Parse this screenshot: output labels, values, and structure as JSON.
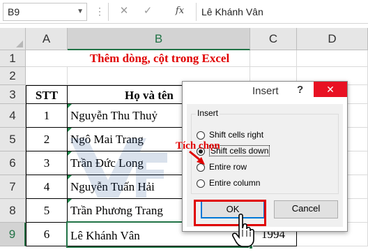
{
  "formula_bar": {
    "name_box": "B9",
    "cancel_icon": "✕",
    "enter_icon": "✓",
    "fx_label": "fx",
    "value": "Lê Khánh Vân"
  },
  "columns": [
    "A",
    "B",
    "C",
    "D"
  ],
  "rows": [
    "1",
    "2",
    "3",
    "4",
    "5",
    "6",
    "7",
    "8",
    "9"
  ],
  "sheet": {
    "title": "Thêm dòng, cột trong Excel",
    "header_stt": "STT",
    "header_name": "Họ và tên",
    "records": [
      {
        "stt": "1",
        "name": "Nguyễn Thu Thuỷ"
      },
      {
        "stt": "2",
        "name": "Ngô Mai Trang"
      },
      {
        "stt": "3",
        "name": "Trần Đức Long"
      },
      {
        "stt": "4",
        "name": "Nguyễn Tuấn Hải"
      },
      {
        "stt": "5",
        "name": "Trần Phương Trang"
      },
      {
        "stt": "6",
        "name": "Lê Khánh Vân",
        "year": "1994"
      }
    ]
  },
  "dialog": {
    "title": "Insert",
    "help": "?",
    "close_icon": "✕",
    "group_label": "Insert",
    "options": [
      {
        "label": "Shift cells right",
        "checked": false
      },
      {
        "label": "Shift cells down",
        "checked": true
      },
      {
        "label": "Entire row",
        "checked": false
      },
      {
        "label": "Entire column",
        "checked": false
      }
    ],
    "ok_label": "OK",
    "cancel_label": "Cancel"
  },
  "annotation": {
    "text": "Tích chọn",
    "color": "#e00000"
  },
  "colors": {
    "excel_green": "#217346",
    "title_red": "#e00000",
    "close_red": "#e81123",
    "focus_blue": "#0078d7"
  },
  "icons": {
    "cursor": "hand-pointer-icon",
    "arrow": "red-arrow-icon"
  }
}
